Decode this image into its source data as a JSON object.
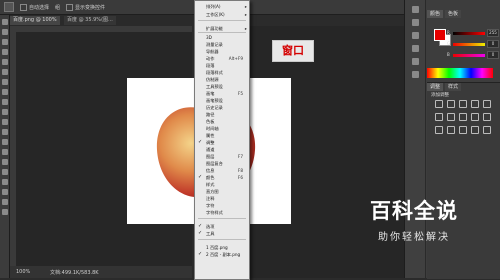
{
  "option_bar": {
    "auto_select_label": "自动选择",
    "auto_select_value": "组",
    "show_transform_label": "显示变换控件"
  },
  "tabs": [
    {
      "label": "百度.png @ 100%"
    },
    {
      "label": "百度 @ 35.9%(图..."
    }
  ],
  "status": {
    "zoom": "100%",
    "doc": "文档:499.1K/583.8K"
  },
  "tag_label": "窗口",
  "menu": {
    "items": [
      {
        "label": "排列(A)",
        "arrow": "▸",
        "check": ""
      },
      {
        "label": "工作区(K)",
        "arrow": "▸",
        "check": ""
      },
      {
        "label": "扩展功能",
        "arrow": "▸",
        "check": ""
      },
      {
        "label": "3D",
        "check": ""
      },
      {
        "label": "测量记录",
        "check": ""
      },
      {
        "label": "导航器",
        "check": ""
      },
      {
        "label": "动作",
        "shortcut": "Alt+F9",
        "check": ""
      },
      {
        "label": "段落",
        "check": ""
      },
      {
        "label": "段落样式",
        "check": ""
      },
      {
        "label": "仿制源",
        "check": ""
      },
      {
        "label": "工具预设",
        "check": ""
      },
      {
        "label": "画笔",
        "shortcut": "F5",
        "check": ""
      },
      {
        "label": "画笔预设",
        "check": ""
      },
      {
        "label": "历史记录",
        "check": ""
      },
      {
        "label": "路径",
        "check": ""
      },
      {
        "label": "色板",
        "check": ""
      },
      {
        "label": "时间轴",
        "check": ""
      },
      {
        "label": "属性",
        "check": ""
      },
      {
        "label": "调整",
        "check": "✓"
      },
      {
        "label": "通道",
        "check": ""
      },
      {
        "label": "图层",
        "shortcut": "F7",
        "check": ""
      },
      {
        "label": "图层复合",
        "check": ""
      },
      {
        "label": "信息",
        "shortcut": "F8",
        "check": ""
      },
      {
        "label": "颜色",
        "shortcut": "F6",
        "check": "✓"
      },
      {
        "label": "样式",
        "check": ""
      },
      {
        "label": "直方图",
        "check": ""
      },
      {
        "label": "注释",
        "check": ""
      },
      {
        "label": "字符",
        "check": ""
      },
      {
        "label": "字符样式",
        "check": ""
      },
      {
        "label": "选项",
        "check": "✓"
      },
      {
        "label": "工具",
        "check": "✓"
      },
      {
        "label": "1 百度.png",
        "check": ""
      },
      {
        "label": "2 百度 - 副本.png",
        "check": "✓"
      }
    ]
  },
  "panels": {
    "color_tab": "颜色",
    "swatch_tab": "色板",
    "adjust_tab": "调整",
    "styles_tab": "样式",
    "add_adjust_label": "添加调整",
    "sliders": [
      {
        "label": "R",
        "value": "255",
        "gradient": "linear-gradient(to right,#000,#f00)"
      },
      {
        "label": "G",
        "value": "0",
        "gradient": "linear-gradient(to right,#e00,#ee0)"
      },
      {
        "label": "B",
        "value": "0",
        "gradient": "linear-gradient(to right,#e00,#e0e)"
      }
    ],
    "fg_color": "#e60000",
    "bg_color": "#ffffff"
  },
  "watermark": {
    "title": "百科全说",
    "subtitle": "助你轻松解决"
  }
}
